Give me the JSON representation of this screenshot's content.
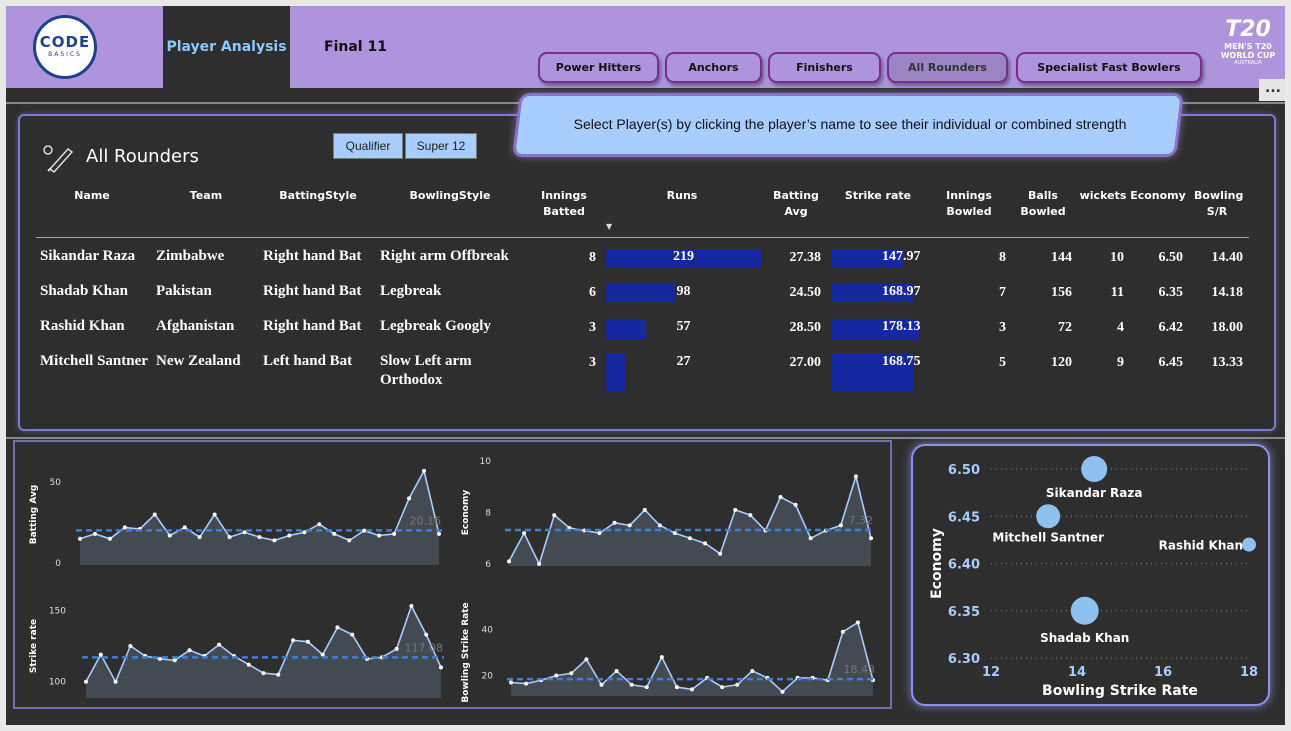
{
  "header": {
    "logo_main": "CODE",
    "logo_sub": "BASICS",
    "tabs": [
      "Player Analysis",
      "Final 11"
    ],
    "categories": [
      "Power Hitters",
      "Anchors",
      "Finishers",
      "All Rounders",
      "Specialist Fast Bowlers"
    ],
    "active_category": "All Rounders",
    "wc_logo": {
      "big": "T20",
      "line1": "MEN'S T20",
      "line2": "WORLD CUP",
      "line3": "AUSTRALIA"
    },
    "more": "..."
  },
  "banner": "Select Player(s) by clicking the player’s name to see their individual or combined strength",
  "table": {
    "title": "All Rounders",
    "filters": [
      "Qualifier",
      "Super 12"
    ],
    "columns": [
      "Name",
      "Team",
      "BattingStyle",
      "BowlingStyle",
      "Innings Batted",
      "Runs",
      "Batting Avg",
      "Strike rate",
      "Innings Bowled",
      "Balls Bowled",
      "wickets",
      "Economy",
      "Bowling S/R"
    ],
    "rows": [
      {
        "name": "Sikandar Raza",
        "team": "Zimbabwe",
        "batting": "Right hand Bat",
        "bowling": "Right arm Offbreak",
        "inn_bat": "8",
        "runs": "219",
        "runs_v": 219,
        "bat_avg": "27.38",
        "sr": "147.97",
        "sr_v": 147.97,
        "inn_bowl": "8",
        "balls": "144",
        "wkts": "10",
        "econ": "6.50",
        "bsr": "14.40"
      },
      {
        "name": "Shadab Khan",
        "team": "Pakistan",
        "batting": "Right hand Bat",
        "bowling": "Legbreak",
        "inn_bat": "6",
        "runs": "98",
        "runs_v": 98,
        "bat_avg": "24.50",
        "sr": "168.97",
        "sr_v": 168.97,
        "inn_bowl": "7",
        "balls": "156",
        "wkts": "11",
        "econ": "6.35",
        "bsr": "14.18"
      },
      {
        "name": "Rashid Khan",
        "team": "Afghanistan",
        "batting": "Right hand Bat",
        "bowling": "Legbreak Googly",
        "inn_bat": "3",
        "runs": "57",
        "runs_v": 57,
        "bat_avg": "28.50",
        "sr": "178.13",
        "sr_v": 178.13,
        "inn_bowl": "3",
        "balls": "72",
        "wkts": "4",
        "econ": "6.42",
        "bsr": "18.00"
      },
      {
        "name": "Mitchell Santner",
        "team": "New Zealand",
        "batting": "Left hand Bat",
        "bowling": "Slow Left arm Orthodox",
        "inn_bat": "3",
        "runs": "27",
        "runs_v": 27,
        "bat_avg": "27.00",
        "sr": "168.75",
        "sr_v": 168.75,
        "inn_bowl": "5",
        "balls": "120",
        "wkts": "9",
        "econ": "6.45",
        "bsr": "13.33"
      }
    ]
  },
  "chart_data": [
    {
      "type": "area",
      "title": "",
      "ylabel": "Batting Avg",
      "ylim": [
        0,
        60
      ],
      "yticks": [
        "50",
        "0"
      ],
      "avg_label": "20.16",
      "avg": 20.16,
      "values": [
        15,
        18,
        15,
        22,
        21,
        30,
        17,
        22,
        16,
        30,
        16,
        19,
        16,
        14,
        17,
        19,
        24,
        18,
        14,
        20,
        17,
        18,
        40,
        57,
        18
      ]
    },
    {
      "type": "area",
      "title": "",
      "ylabel": "Economy",
      "ylim": [
        6,
        10
      ],
      "yticks": [
        "10",
        "8",
        "6"
      ],
      "avg_label": "7.32",
      "avg": 7.32,
      "values": [
        6.1,
        7.2,
        6.0,
        7.9,
        7.4,
        7.3,
        7.2,
        7.6,
        7.5,
        8.1,
        7.5,
        7.2,
        7.0,
        6.8,
        6.4,
        8.1,
        7.9,
        7.3,
        8.6,
        8.3,
        7.0,
        7.3,
        7.5,
        9.4,
        7.0
      ]
    },
    {
      "type": "area",
      "title": "",
      "ylabel": "Strike rate",
      "ylim": [
        90,
        160
      ],
      "yticks": [
        "150",
        "100"
      ],
      "avg_label": "117.08",
      "avg": 117.08,
      "values": [
        100,
        119,
        100,
        125,
        118,
        116,
        115,
        122,
        118,
        126,
        118,
        112,
        106,
        105,
        129,
        128,
        119,
        138,
        133,
        116,
        117,
        123,
        153,
        133,
        110
      ]
    },
    {
      "type": "area",
      "title": "",
      "ylabel": "Bowling Strike Rate",
      "ylim": [
        12,
        48
      ],
      "yticks": [
        "40",
        "20"
      ],
      "avg_label": "18.43",
      "avg": 18.43,
      "values": [
        17,
        16.5,
        18,
        20,
        21,
        27,
        16,
        22,
        16,
        15,
        28,
        15,
        14,
        19,
        15,
        16,
        22,
        19,
        13,
        19,
        19,
        18,
        39,
        43,
        18
      ]
    },
    {
      "type": "scatter",
      "xlabel": "Bowling Strike Rate",
      "ylabel": "Economy",
      "xlim": [
        12,
        18
      ],
      "ylim": [
        6.3,
        6.5
      ],
      "xticks": [
        "12",
        "14",
        "16",
        "18"
      ],
      "yticks": [
        "6.50",
        "6.45",
        "6.40",
        "6.35",
        "6.30"
      ],
      "points": [
        {
          "label": "Sikandar Raza",
          "x": 14.4,
          "y": 6.5,
          "size": 10
        },
        {
          "label": "Mitchell Santner",
          "x": 13.33,
          "y": 6.45,
          "size": 9
        },
        {
          "label": "Rashid Khan",
          "x": 18.0,
          "y": 6.42,
          "size": 4
        },
        {
          "label": "Shadab Khan",
          "x": 14.18,
          "y": 6.35,
          "size": 11
        }
      ]
    }
  ]
}
